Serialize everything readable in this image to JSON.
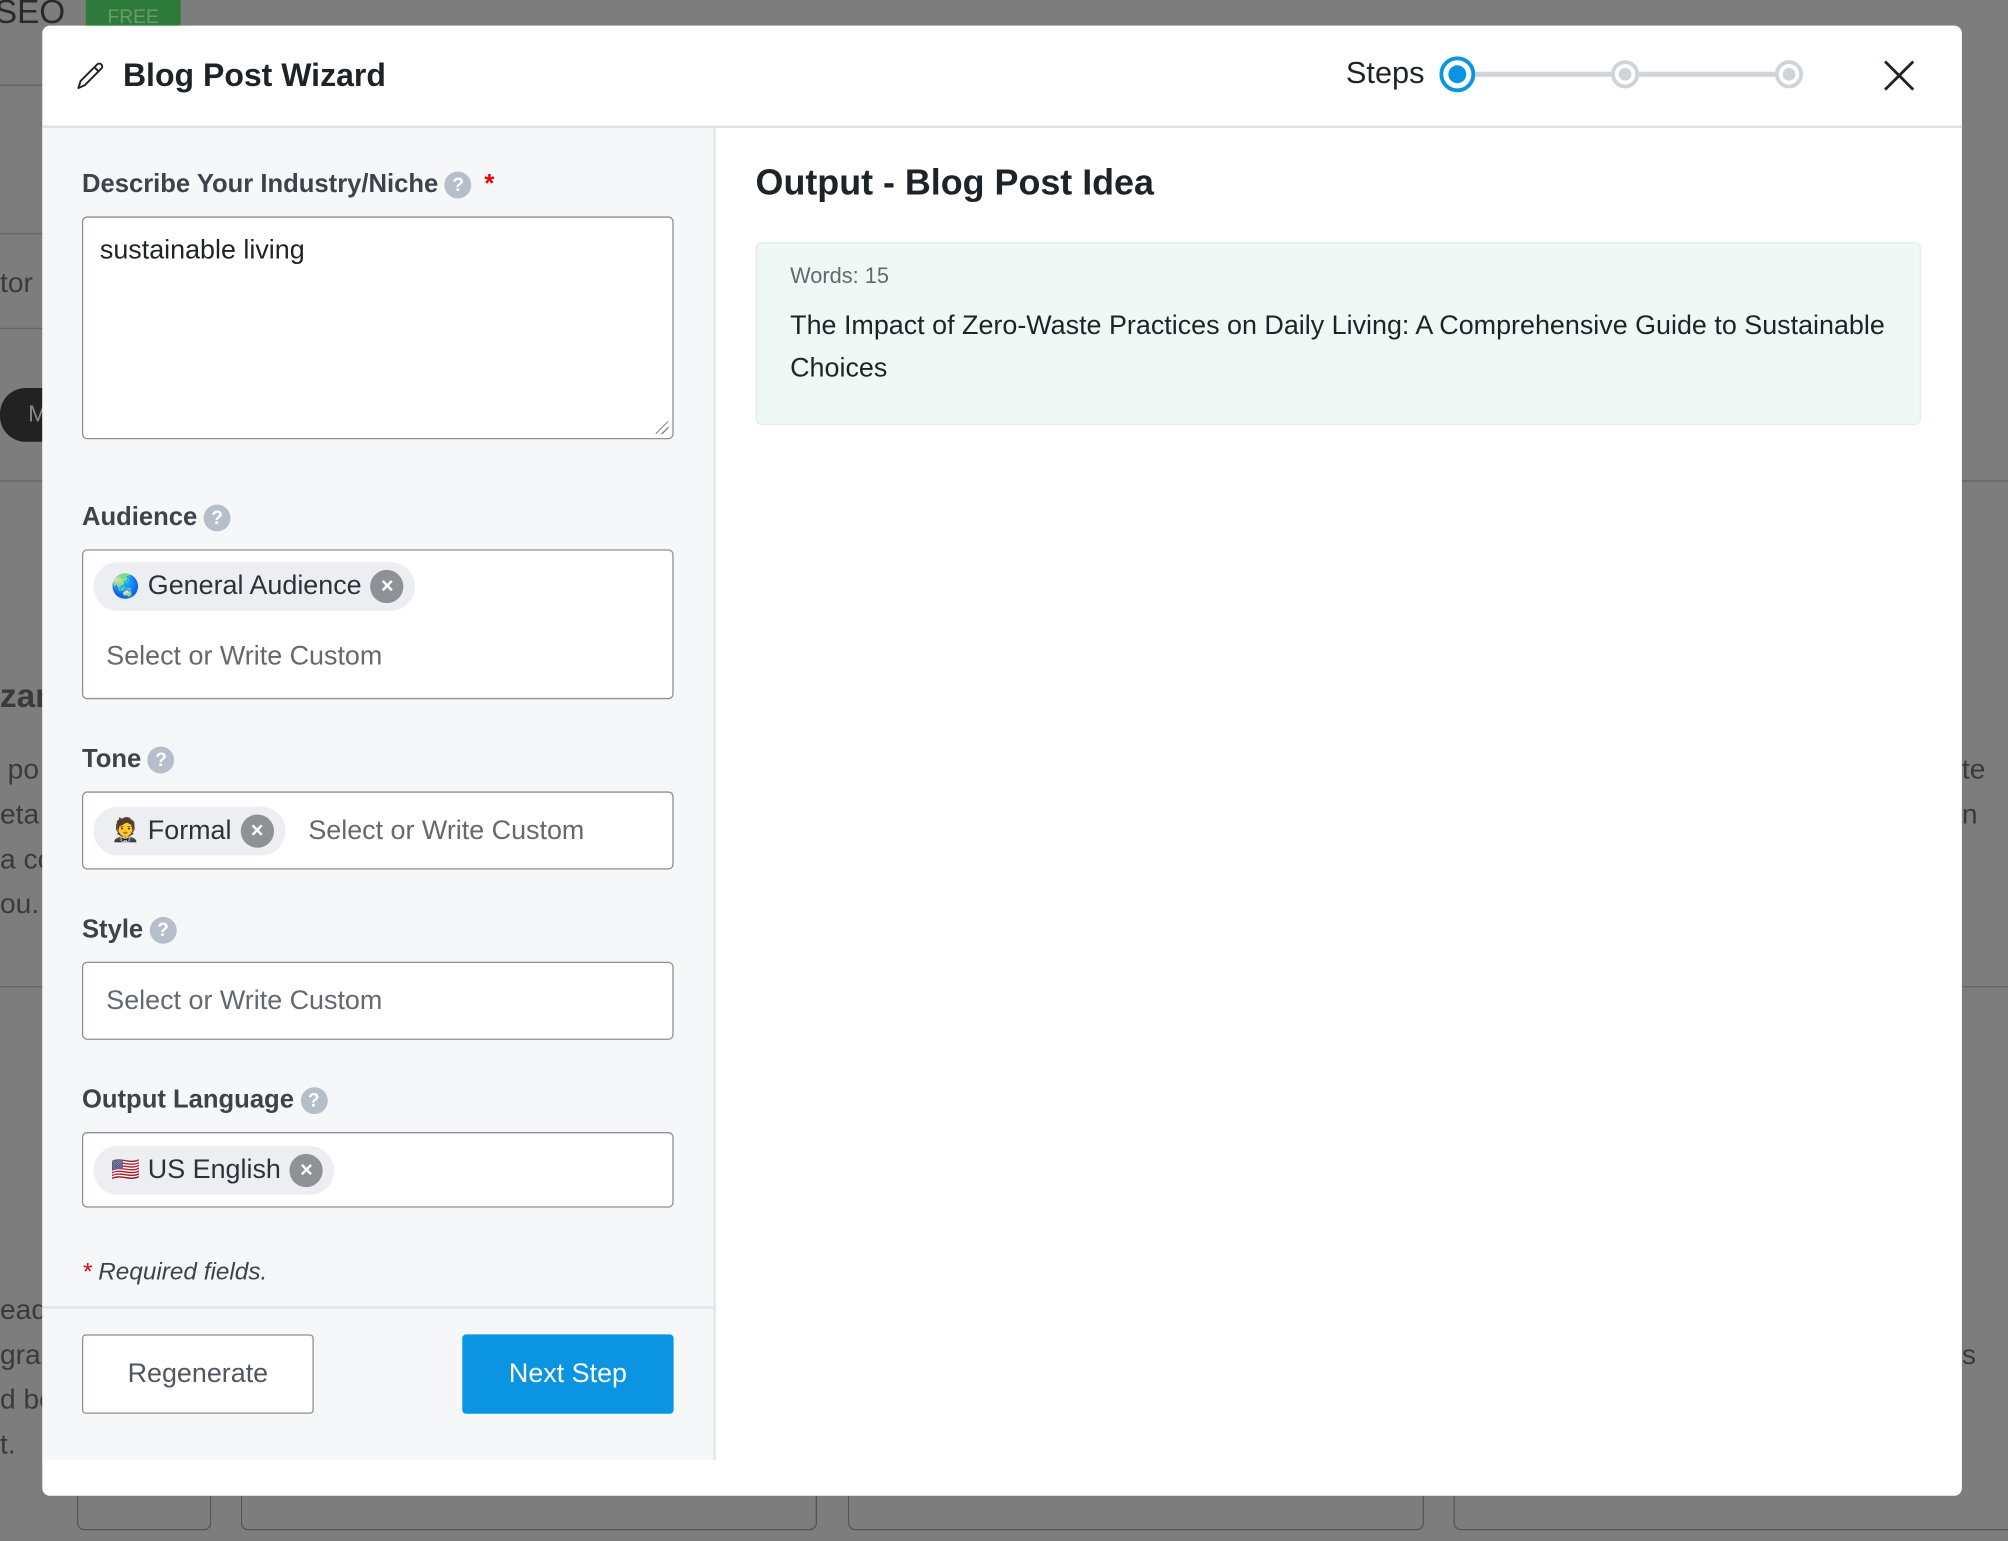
{
  "background": {
    "brand": "SEO",
    "badge": "FREE",
    "fragments": [
      "tor",
      "M",
      "zar",
      "po",
      "eta",
      "a co",
      "ou.",
      "ead",
      "grab",
      "d bo",
      "t.",
      "te",
      "n",
      "s"
    ]
  },
  "header": {
    "icon": "pencil-icon",
    "title": "Blog Post Wizard",
    "steps_label": "Steps",
    "steps_total": 3,
    "current_step": 1,
    "close_icon": "close-icon"
  },
  "form": {
    "industry": {
      "label": "Describe Your Industry/Niche",
      "help": "?",
      "required_mark": "*",
      "value": "sustainable living"
    },
    "audience": {
      "label": "Audience",
      "help": "?",
      "chips": [
        {
          "emoji": "🌏",
          "label": "General Audience",
          "remove": "×"
        }
      ],
      "placeholder": "Select or Write Custom"
    },
    "tone": {
      "label": "Tone",
      "help": "?",
      "chips": [
        {
          "emoji": "🤵",
          "label": "Formal",
          "remove": "×"
        }
      ],
      "placeholder": "Select or Write Custom"
    },
    "style": {
      "label": "Style",
      "help": "?",
      "placeholder": "Select or Write Custom"
    },
    "language": {
      "label": "Output Language",
      "help": "?",
      "chips": [
        {
          "emoji": "🇺🇸",
          "label": "US English",
          "remove": "×"
        }
      ]
    },
    "required_mark": "*",
    "required_note": "Required fields."
  },
  "buttons": {
    "regenerate": "Regenerate",
    "next": "Next Step"
  },
  "output": {
    "title": "Output - Blog Post Idea",
    "words": "Words: 15",
    "text": "The Impact of Zero-Waste Practices on Daily Living: A Comprehensive Guide to Sustainable Choices"
  },
  "colors": {
    "accent": "#0a94e2",
    "required": "#ee0000",
    "output_bg": "#eff8f5",
    "overlay": "#7d7d7d"
  }
}
